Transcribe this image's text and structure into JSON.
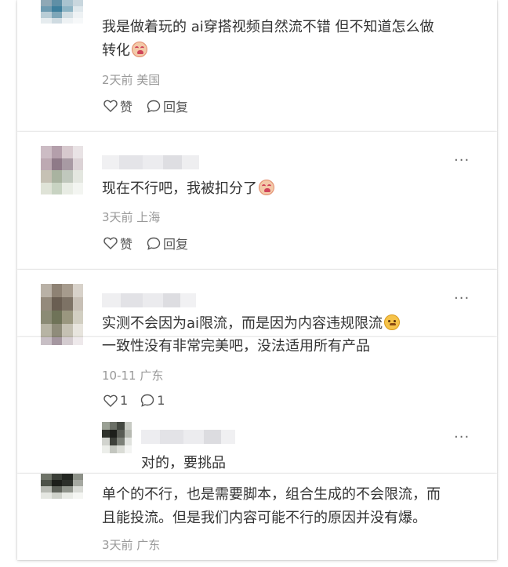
{
  "comments": [
    {
      "text_line1": "我是做着玩的 ai穿搭视频自然流不错 但不知道怎么做",
      "text_line2": "转化",
      "emoji": "crying-face-emoji",
      "meta": "2天前 美国",
      "like_label": "赞",
      "reply_label": "回复"
    },
    {
      "text": "现在不行吧，我被扣分了",
      "emoji": "crying-face-emoji",
      "meta": "3天前 上海",
      "like_label": "赞",
      "reply_label": "回复",
      "more": "···"
    },
    {
      "text": "实测不会因为ai限流，而是因为内容违规限流",
      "emoji": "smirking-face-emoji",
      "more": "···"
    },
    {
      "text": "一致性没有非常完美吧，没法适用所有产品",
      "meta": "10-11 广东",
      "like_count": "1",
      "reply_count": "1"
    },
    {
      "text": "对的，要挑品",
      "more": "···"
    },
    {
      "text_line1": "单个的不行，也是需要脚本，组合生成的不会限流，而",
      "text_line2": "且能投流。但是我们内容可能不行的原因并没有爆。",
      "meta": "3天前 广东"
    }
  ]
}
